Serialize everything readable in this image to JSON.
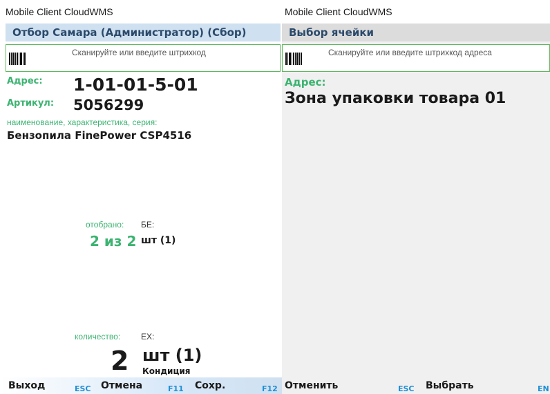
{
  "left": {
    "window_title": "Mobile Client CloudWMS",
    "header": "Отбор Самара (Администратор) (Сбор)",
    "scan_placeholder": "Сканируйте или введите штрихкод",
    "address_label": "Адрес:",
    "address_value": "1-01-01-5-01",
    "article_label": "Артикул:",
    "article_value": "5056299",
    "desc_label": "наименование,  характеристика,  серия:",
    "desc_value": "Бензопила FinePower CSP4516",
    "picked_label": "отобрано:",
    "picked_unit_label": "БЕ:",
    "picked_value": "2 из 2",
    "picked_unit": "шт (1)",
    "qty_label": "количество:",
    "qty_unit_label": "ЕХ:",
    "qty_value": "2",
    "qty_unit": "шт (1)",
    "condition": "Кондиция",
    "buttons": {
      "exit": "Выход",
      "exit_key": "ESC",
      "cancel": "Отмена",
      "cancel_key": "F11",
      "save": "Сохр.",
      "save_key": "F12"
    }
  },
  "right": {
    "window_title": "Mobile Client CloudWMS",
    "header": "Выбор ячейки",
    "scan_placeholder": "Сканируйте или введите штрихкод адреса",
    "address_label": "Адрес:",
    "address_value": "Зона упаковки товара 01",
    "buttons": {
      "cancel": "Отменить",
      "cancel_key": "ESC",
      "select": "Выбрать",
      "select_key": "EN"
    }
  },
  "colors": {
    "accent_green": "#3cb371",
    "header_blue": "#cfe0f0",
    "key_blue": "#1f8fd6",
    "border_green": "#5cb85c"
  },
  "icons": [
    "barcode-icon"
  ]
}
